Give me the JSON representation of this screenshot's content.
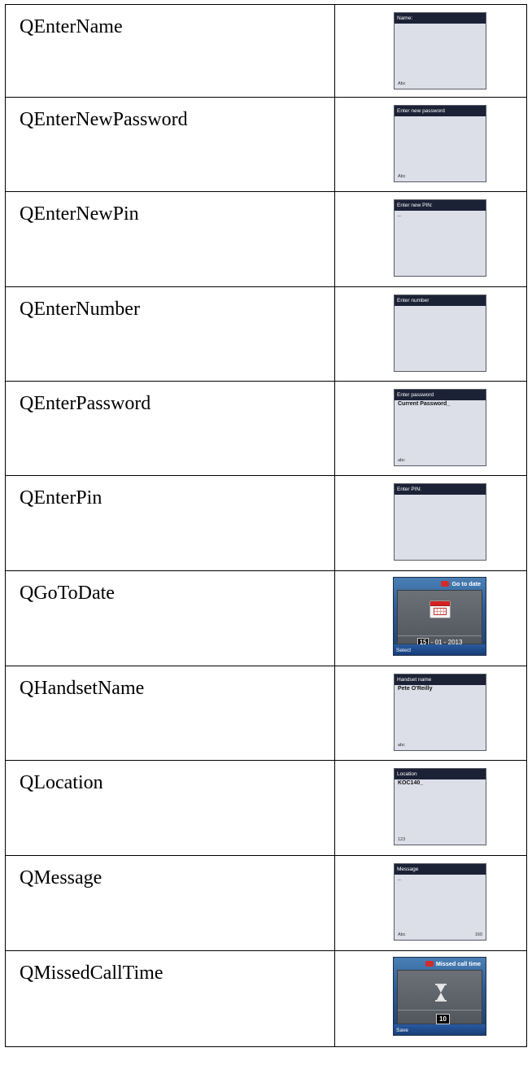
{
  "rows": [
    {
      "name": "QEnterName",
      "header": "Name:",
      "value": "",
      "mode": "Abc",
      "count": ""
    },
    {
      "name": "QEnterNewPassword",
      "header": "Enter new password",
      "value": "",
      "mode": "Abc",
      "count": ""
    },
    {
      "name": "QEnterNewPin",
      "header": "Enter new PIN:",
      "value": "_",
      "mode": "",
      "count": ""
    },
    {
      "name": "QEnterNumber",
      "header": "Enter number",
      "value": "",
      "mode": "",
      "count": ""
    },
    {
      "name": "QEnterPassword",
      "header": "Enter password",
      "value": "Current Password_",
      "mode": "abc",
      "count": ""
    },
    {
      "name": "QEnterPin",
      "header": "Enter PIN:",
      "value": "",
      "mode": "",
      "count": ""
    },
    {
      "name": "QGoToDate",
      "title": "Go to date",
      "day": "15",
      "rest": "- 01 -  2013",
      "softkey": "Select"
    },
    {
      "name": "QHandsetName",
      "header": "Handset name",
      "value": "Pete O'Reilly",
      "mode": "abc",
      "count": ""
    },
    {
      "name": "QLocation",
      "header": "Location",
      "value": "KOC140_",
      "mode": "123",
      "count": ""
    },
    {
      "name": "QMessage",
      "header": "Message",
      "value": "_",
      "mode": "Abc",
      "count": "160"
    },
    {
      "name": "QMissedCallTime",
      "title": "Missed call time",
      "number": "10",
      "softkey": "Save"
    }
  ]
}
